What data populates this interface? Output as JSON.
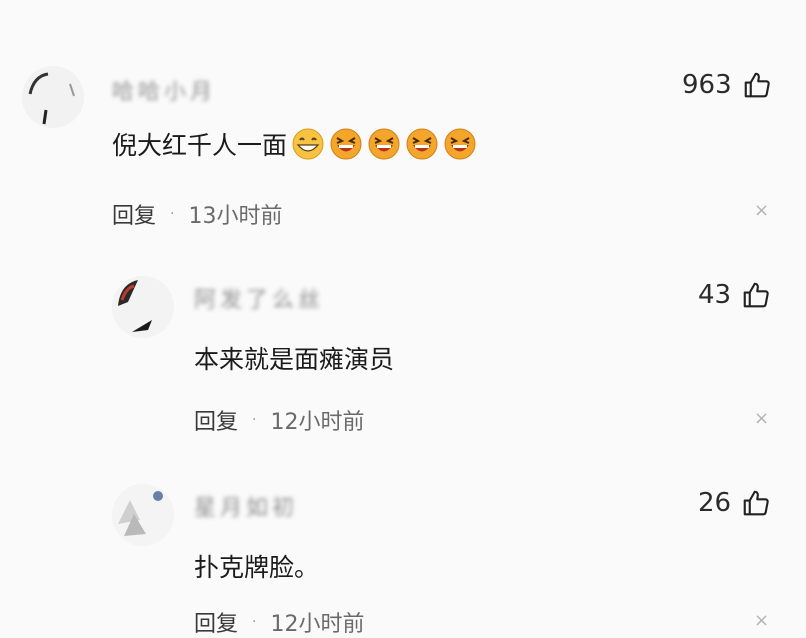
{
  "comments": [
    {
      "username": "哈哈小月",
      "likes": "963",
      "text": "倪大红千人一面",
      "emojis": [
        "grin-emoji",
        "laugh-emoji",
        "laugh-emoji",
        "laugh-emoji",
        "laugh-emoji"
      ],
      "reply_label": "回复",
      "dot": "·",
      "time": "13小时前",
      "close_glyph": "×"
    },
    {
      "username": "阿发了么丝",
      "likes": "43",
      "text": "本来就是面瘫演员",
      "reply_label": "回复",
      "dot": "·",
      "time": "12小时前",
      "close_glyph": "×"
    },
    {
      "username": "星月如初",
      "likes": "26",
      "text": "扑克牌脸。",
      "reply_label": "回复",
      "dot": "·",
      "time": "12小时前",
      "close_glyph": "×"
    }
  ],
  "colors": {
    "background": "#fafafa",
    "text": "#1b1b1b",
    "meta": "#6a6a6a",
    "emoji_face": "#f5b21f",
    "emoji_mouth": "#b8331e"
  },
  "icons": {
    "like": "thumbs-up-icon",
    "close": "close-icon"
  }
}
